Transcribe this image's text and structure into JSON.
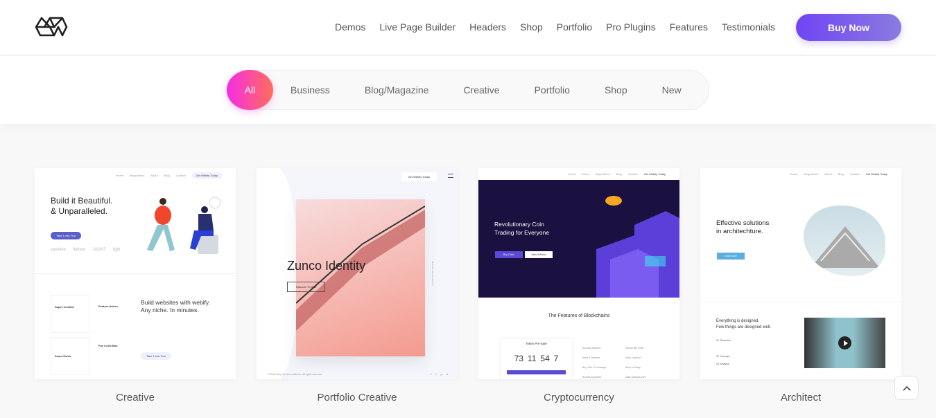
{
  "header": {
    "nav": [
      "Demos",
      "Live Page Builder",
      "Headers",
      "Shop",
      "Portfolio",
      "Pro Plugins",
      "Features",
      "Testimonials"
    ],
    "buy_label": "Buy Now"
  },
  "filters": {
    "items": [
      "All",
      "Business",
      "Blog/Magazine",
      "Creative",
      "Portfolio",
      "Shop",
      "New"
    ],
    "active": "All"
  },
  "colors": {
    "accent_purple": "#7044f5",
    "filter_gradient_start": "#f52de6",
    "filter_gradient_end": "#ff6d5a"
  },
  "demos": [
    {
      "label": "Creative",
      "nav": [
        "Home",
        "Mega Menu",
        "About",
        "Blog",
        "Contact"
      ],
      "cta": "Get Webify Today",
      "title1": "Build it Beautiful.",
      "title2": "& Unparalleled.",
      "button": "Take 1-min Tour",
      "brands": [
        "saviolee",
        "flattern",
        "JAUNT",
        "light"
      ],
      "features": [
        "Super Creative",
        "Feature-driven",
        "Avant Garde",
        "Fox in the Box"
      ],
      "heading1": "Build websites with webify.",
      "heading2": "Any niche. In minutes.",
      "button2": "Take 1-min Tour"
    },
    {
      "label": "Portfolio Creative",
      "cta": "Get Webify Today",
      "title": "Zunco Identity",
      "button": "Discover Project",
      "side": "MOTION PHOTOGRAPHY",
      "footer": "© Built with pride and caffeines. All rights reserved",
      "social": [
        "f",
        "t",
        "p",
        "o"
      ]
    },
    {
      "label": "Cryptocurrency",
      "nav": [
        "Home",
        "About",
        "Mega Menu",
        "Blog",
        "Contact"
      ],
      "cta": "Get Webify Today",
      "title1": "Revolutionary Coin",
      "title2": "Trading for Everyone",
      "button1": "Buy Coins",
      "button2": "View It Works",
      "features_title": "The Features of Blockchains",
      "presale": "Token Pre-Sale",
      "countdown": [
        "73",
        "11",
        "54",
        "7"
      ],
      "features": [
        "Security Assured",
        "Secure like Forte",
        "Send & Receive",
        "Easy Cashout",
        "Buy, Sell, & Exchange",
        "Easy to Setup",
        "Access Anywhere",
        "Daily backups 24/7"
      ]
    },
    {
      "label": "Architect",
      "nav": [
        "Home",
        "Mega Menu",
        "About",
        "Blog",
        "Contact"
      ],
      "cta": "Get Webify Today",
      "title1": "Effective solutions",
      "title2": "in architechture.",
      "button": "Learn More",
      "heading1": "Everything is designed.",
      "heading2": "Few things are designed well.",
      "list": [
        "01. Research",
        "02. Concept",
        "03. Analysis"
      ]
    }
  ]
}
